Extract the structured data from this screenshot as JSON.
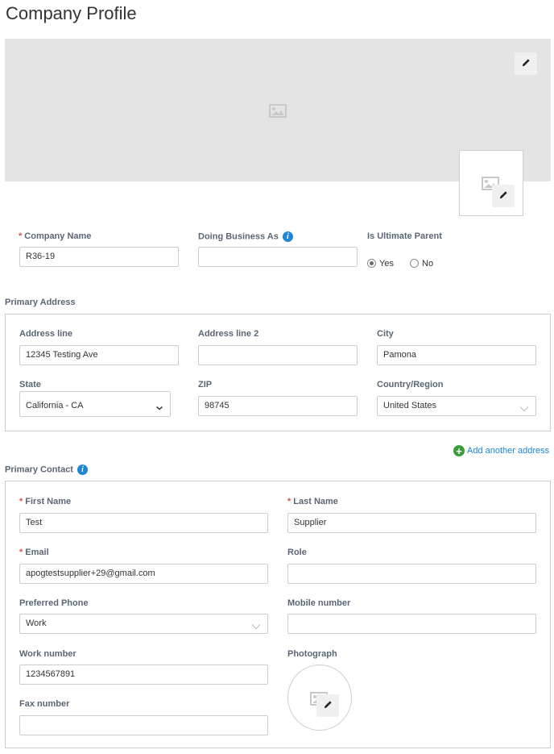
{
  "page": {
    "title": "Company Profile"
  },
  "banner": {
    "image_icon": "image-placeholder-icon",
    "edit_icon": "pencil-icon"
  },
  "logo": {
    "image_icon": "image-placeholder-icon",
    "edit_icon": "pencil-icon"
  },
  "company": {
    "company_name": {
      "label": "Company Name",
      "required": "*",
      "value": "R36-19"
    },
    "doing_business_as": {
      "label": "Doing Business As",
      "value": "",
      "info_icon": "info-icon"
    },
    "ultimate_parent": {
      "label": "Is Ultimate Parent",
      "options": [
        {
          "label": "Yes",
          "checked": true
        },
        {
          "label": "No",
          "checked": false
        }
      ]
    }
  },
  "primary_address": {
    "title": "Primary Address",
    "address_line": {
      "label": "Address line",
      "value": "12345 Testing Ave"
    },
    "address_line_2": {
      "label": "Address line 2",
      "value": ""
    },
    "city": {
      "label": "City",
      "value": "Pamona"
    },
    "state": {
      "label": "State",
      "value": "California - CA"
    },
    "zip": {
      "label": "ZIP",
      "value": "98745"
    },
    "country": {
      "label": "Country/Region",
      "value": "United States"
    }
  },
  "add_address": {
    "label": "Add another address",
    "icon": "plus-circle-icon",
    "color": "#3b9d3b"
  },
  "primary_contact": {
    "title": "Primary Contact",
    "first_name": {
      "label": "First Name",
      "required": "*",
      "value": "Test"
    },
    "last_name": {
      "label": "Last Name",
      "required": "*",
      "value": "Supplier"
    },
    "email": {
      "label": "Email",
      "required": "*",
      "value": "apogtestsupplier+29@gmail.com"
    },
    "role": {
      "label": "Role",
      "value": ""
    },
    "preferred_phone": {
      "label": "Preferred Phone",
      "value": "Work"
    },
    "mobile_number": {
      "label": "Mobile number",
      "value": ""
    },
    "work_number": {
      "label": "Work number",
      "value": "1234567891"
    },
    "photograph": {
      "label": "Photograph"
    },
    "fax_number": {
      "label": "Fax number",
      "value": ""
    }
  },
  "colors": {
    "accent": "#1e86d4",
    "required": "#d9534f",
    "label": "#5a6675",
    "banner_bg": "#e4e4e4"
  }
}
